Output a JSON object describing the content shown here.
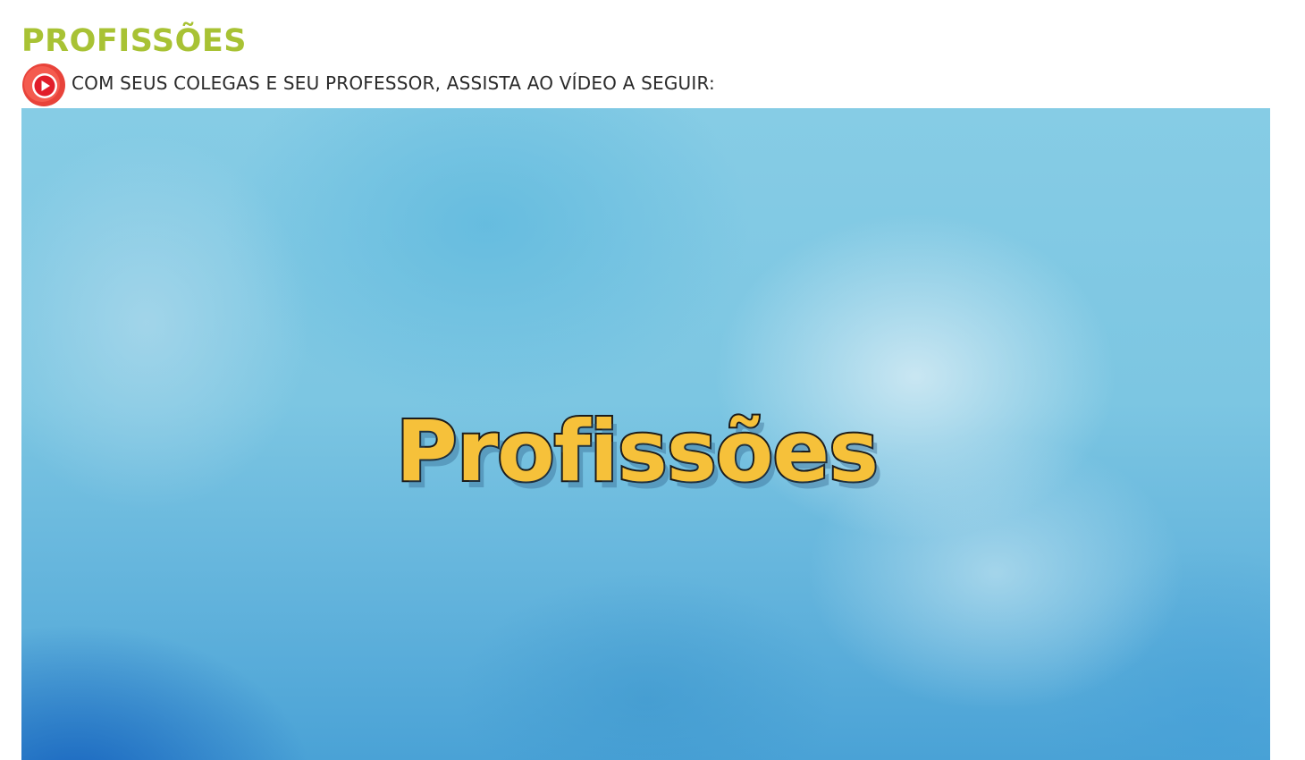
{
  "page": {
    "title": "PROFISSÕES",
    "instruction": "COM SEUS COLEGAS E SEU PROFESSOR, ASSISTA AO VÍDEO A SEGUIR:",
    "play_icon": "play-icon"
  },
  "video": {
    "thumbnail_title": "Profissões",
    "background_colors": [
      "#86cce5",
      "#4aa2d6",
      "#1662be"
    ],
    "title_fill": "#f6c13a",
    "title_outline": "#1b1b1b"
  },
  "colors": {
    "heading": "#a8c234",
    "play_badge": "#e84c3d",
    "instruction_text": "#2a2a2a"
  }
}
